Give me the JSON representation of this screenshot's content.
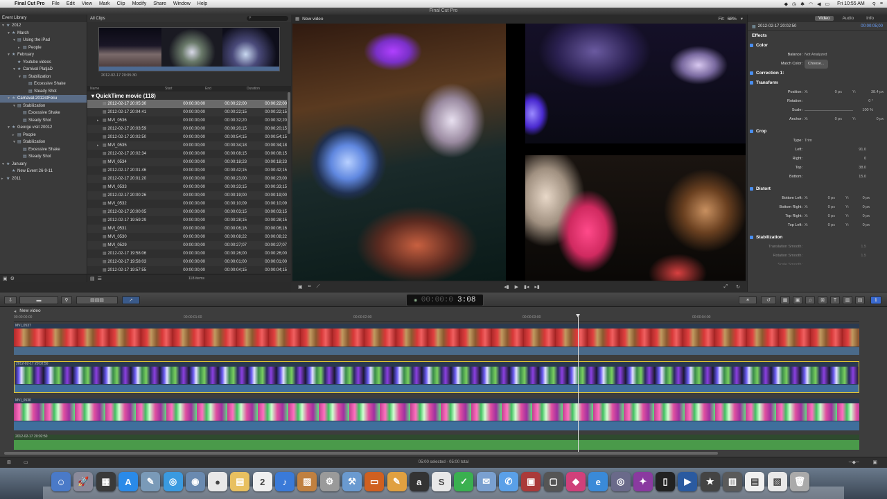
{
  "menubar": {
    "app": "Final Cut Pro",
    "items": [
      "File",
      "Edit",
      "View",
      "Mark",
      "Clip",
      "Modify",
      "Share",
      "Window",
      "Help"
    ],
    "clock": "Fri 10:55 AM"
  },
  "window_title": "Final Cut Pro",
  "library": {
    "header": "Event Library",
    "items": [
      {
        "label": "2012",
        "indent": 0,
        "tri": "▼",
        "icon": "★",
        "selected": false
      },
      {
        "label": "March",
        "indent": 1,
        "tri": "▼",
        "icon": "★",
        "selected": false
      },
      {
        "label": "Using the iPad",
        "indent": 2,
        "tri": "▼",
        "icon": "▤",
        "selected": false
      },
      {
        "label": "People",
        "indent": 3,
        "tri": "▸",
        "icon": "▤",
        "selected": false
      },
      {
        "label": "February",
        "indent": 1,
        "tri": "▼",
        "icon": "★",
        "selected": false
      },
      {
        "label": "Youtube videos",
        "indent": 2,
        "tri": "",
        "icon": "★",
        "selected": false
      },
      {
        "label": "Carnival PlatjaD",
        "indent": 2,
        "tri": "▼",
        "icon": "★",
        "selected": false
      },
      {
        "label": "Stabilization",
        "indent": 3,
        "tri": "▼",
        "icon": "▤",
        "selected": false
      },
      {
        "label": "Excessive Shake",
        "indent": 4,
        "tri": "",
        "icon": "▤",
        "selected": false
      },
      {
        "label": "Steady Shot",
        "indent": 4,
        "tri": "",
        "icon": "▤",
        "selected": false
      },
      {
        "label": "Carnaval-2012stFeliu",
        "indent": 1,
        "tri": "▼",
        "icon": "★",
        "selected": true
      },
      {
        "label": "Stabilization",
        "indent": 2,
        "tri": "▼",
        "icon": "▤",
        "selected": false
      },
      {
        "label": "Excessive Shake",
        "indent": 3,
        "tri": "",
        "icon": "▤",
        "selected": false
      },
      {
        "label": "Steady Shot",
        "indent": 3,
        "tri": "",
        "icon": "▤",
        "selected": false
      },
      {
        "label": "George visit 20012",
        "indent": 1,
        "tri": "▼",
        "icon": "★",
        "selected": false
      },
      {
        "label": "People",
        "indent": 2,
        "tri": "▸",
        "icon": "▤",
        "selected": false
      },
      {
        "label": "Stabilization",
        "indent": 2,
        "tri": "▼",
        "icon": "▤",
        "selected": false
      },
      {
        "label": "Excessive Shake",
        "indent": 3,
        "tri": "",
        "icon": "▤",
        "selected": false
      },
      {
        "label": "Steady Shot",
        "indent": 3,
        "tri": "",
        "icon": "▤",
        "selected": false
      },
      {
        "label": "January",
        "indent": 0,
        "tri": "▼",
        "icon": "★",
        "selected": false
      },
      {
        "label": "New Event 26-9-11",
        "indent": 1,
        "tri": "",
        "icon": "★",
        "selected": false
      },
      {
        "label": "2011",
        "indent": 0,
        "tri": "▸",
        "icon": "★",
        "selected": false
      }
    ]
  },
  "browser": {
    "filter": "All Clips",
    "filmstrip_date": "2012-02-17 20:05:30",
    "columns": {
      "name": "Name",
      "start": "Start",
      "end": "End",
      "duration": "Duration"
    },
    "group": "QuickTime movie  (118)",
    "rows": [
      {
        "name": "2012-02-17 20:05:30",
        "start": "00:00:00;00",
        "end": "00:00:22;00",
        "dur": "00:00:22;00",
        "tri": false,
        "sel": true
      },
      {
        "name": "2012-02-17 20:04:41",
        "start": "00:00:00;00",
        "end": "00:00:22;15",
        "dur": "00:00:22;15",
        "tri": false,
        "sel": false
      },
      {
        "name": "MVI_0536",
        "start": "00:00:00;00",
        "end": "00:00:32;20",
        "dur": "00:00:32;20",
        "tri": true,
        "sel": false
      },
      {
        "name": "2012-02-17 20:03:59",
        "start": "00:00:00;00",
        "end": "00:00:20;15",
        "dur": "00:00:20;15",
        "tri": false,
        "sel": false
      },
      {
        "name": "2012-02-17 20:02:50",
        "start": "00:00:00;00",
        "end": "00:00:54;15",
        "dur": "00:00:54;15",
        "tri": false,
        "sel": false
      },
      {
        "name": "MVI_0535",
        "start": "00:00:00;00",
        "end": "00:00:34;18",
        "dur": "00:00:34;18",
        "tri": true,
        "sel": false
      },
      {
        "name": "2012-02-17 20:02:34",
        "start": "00:00:00;00",
        "end": "00:00:08;15",
        "dur": "00:00:08;15",
        "tri": false,
        "sel": false
      },
      {
        "name": "MVI_0534",
        "start": "00:00:00;00",
        "end": "00:00:18;23",
        "dur": "00:00:18;23",
        "tri": false,
        "sel": false
      },
      {
        "name": "2012-02-17 20:01:46",
        "start": "00:00:00;00",
        "end": "00:00:42;15",
        "dur": "00:00:42;15",
        "tri": false,
        "sel": false
      },
      {
        "name": "2012-02-17 20:01:20",
        "start": "00:00:00;00",
        "end": "00:00:23;00",
        "dur": "00:00:23;00",
        "tri": false,
        "sel": false
      },
      {
        "name": "MVI_0533",
        "start": "00:00:00;00",
        "end": "00:00:33;15",
        "dur": "00:00:33;15",
        "tri": false,
        "sel": false
      },
      {
        "name": "2012-02-17 20:00:26",
        "start": "00:00:00;00",
        "end": "00:00:19;00",
        "dur": "00:00:19;00",
        "tri": false,
        "sel": false
      },
      {
        "name": "MVI_0532",
        "start": "00:00:00;00",
        "end": "00:00:10;09",
        "dur": "00:00:10;09",
        "tri": false,
        "sel": false
      },
      {
        "name": "2012-02-17 20:00:05",
        "start": "00:00:00;00",
        "end": "00:00:03;15",
        "dur": "00:00:03;15",
        "tri": false,
        "sel": false
      },
      {
        "name": "2012-02-17 19:59:29",
        "start": "00:00:00;00",
        "end": "00:00:28;15",
        "dur": "00:00:28;15",
        "tri": false,
        "sel": false
      },
      {
        "name": "MVI_0531",
        "start": "00:00:00;00",
        "end": "00:00:06;16",
        "dur": "00:00:06;16",
        "tri": false,
        "sel": false
      },
      {
        "name": "MVI_0530",
        "start": "00:00:00;00",
        "end": "00:00:08;22",
        "dur": "00:00:08;22",
        "tri": false,
        "sel": false
      },
      {
        "name": "MVI_0529",
        "start": "00:00:00;00",
        "end": "00:00:27;07",
        "dur": "00:00:27;07",
        "tri": false,
        "sel": false
      },
      {
        "name": "2012-02-17 19:58:06",
        "start": "00:00:00;00",
        "end": "00:00:26;00",
        "dur": "00:00:26;00",
        "tri": false,
        "sel": false
      },
      {
        "name": "2012-02-17 19:58:03",
        "start": "00:00:00;00",
        "end": "00:00:01;00",
        "dur": "00:00:01;00",
        "tri": false,
        "sel": false
      },
      {
        "name": "2012-02-17 19:57:55",
        "start": "00:00:00;00",
        "end": "00:00:04;15",
        "dur": "00:00:04;15",
        "tri": false,
        "sel": false
      }
    ],
    "count": "118 items"
  },
  "viewer": {
    "project": "New video",
    "fit_label": "Fit:",
    "fit_value": "68%"
  },
  "inspector": {
    "tabs": [
      "Video",
      "Audio",
      "Info"
    ],
    "active_tab": "Video",
    "clip_name": "2012-02-17 20:02:50",
    "clip_tc": "00:00:05;00",
    "sections": {
      "effects": "Effects",
      "color": "Color",
      "balance_label": "Balance:",
      "balance_value": "Not Analyzed",
      "match_label": "Match Color:",
      "match_button": "Choose...",
      "correction": "Correction 1:",
      "transform": "Transform",
      "position_label": "Position:",
      "position_x_label": "X:",
      "position_x": "0 px",
      "position_y_label": "Y:",
      "position_y": "38.4 px",
      "rotation_label": "Rotation:",
      "rotation_value": "0 °",
      "scale_label": "Scale:",
      "scale_value": "100 %",
      "anchor_label": "Anchor:",
      "anchor_x_label": "X:",
      "anchor_x": "0 px",
      "anchor_y_label": "Y:",
      "anchor_y": "0 px",
      "crop": "Crop",
      "type_label": "Type:",
      "type_value": "Trim",
      "left_label": "Left:",
      "left_value": "91.0",
      "right_label": "Right:",
      "right_value": "0",
      "top_label": "Top:",
      "top_value": "38.0",
      "bottom_label": "Bottom:",
      "bottom_value": "15.0",
      "distort": "Distort",
      "bl_label": "Bottom Left:",
      "bl_x": "0 px",
      "bl_y": "0 px",
      "br_label": "Bottom Right:",
      "br_x": "0 px",
      "br_y": "0 px",
      "tr_label": "Top Right:",
      "tr_x": "0 px",
      "tr_y": "0 px",
      "tl_label": "Top Left:",
      "tl_x": "0 px",
      "tl_y": "0 px",
      "x_label": "X:",
      "y_label": "Y:",
      "stabilization": "Stabilization",
      "translation_label": "Translation Smooth:",
      "translation_value": "1.5",
      "rotation_smooth_label": "Rotation Smooth:",
      "rotation_smooth_value": "1.5",
      "scale_smooth_label": "Scale Smooth:"
    }
  },
  "toolbar": {
    "timecode": "3:08",
    "timecode_dim": "00:00:0"
  },
  "timeline": {
    "project": "New video",
    "ruler": [
      "00:00:00:00",
      "00:00:01:00",
      "00:00:02:00",
      "00:00:03:00",
      "00:00:04:00"
    ],
    "tracks": [
      {
        "label": "MVI_0537"
      },
      {
        "label": "2012-02-17 20:02:50"
      },
      {
        "label": "MVI_0530"
      },
      {
        "label": "2012-02-17 20:02:50"
      }
    ]
  },
  "status": "05:00 selected - 05:00 total",
  "colors": {
    "accent": "#4a8ff0",
    "selection": "#5a6c86",
    "audio": "#3f6f9c",
    "audio_green": "#4a9a4a",
    "timeline_bg": "#3d3d3d"
  },
  "dock": {
    "icons": [
      "finder-icon",
      "launchpad-icon",
      "dashboard-icon",
      "app-store-icon",
      "preview-icon",
      "safari-icon",
      "network-icon",
      "chrome-icon",
      "notes-icon",
      "calendar-icon",
      "itunes-icon",
      "iphoto-icon",
      "system-preferences-icon",
      "utility-icon",
      "keynote-icon",
      "pages-icon",
      "amazon-icon",
      "skype-icon",
      "evernote-icon",
      "mail-icon",
      "messages-icon",
      "photobooth-icon",
      "screen-icon",
      "gem-icon",
      "ie-icon",
      "vmware-icon",
      "alfred-icon",
      "terminal-icon",
      "screenflow-icon",
      "imovie-icon",
      "claquette-icon",
      "document-icon",
      "preview-doc-icon",
      "trash-icon"
    ]
  }
}
